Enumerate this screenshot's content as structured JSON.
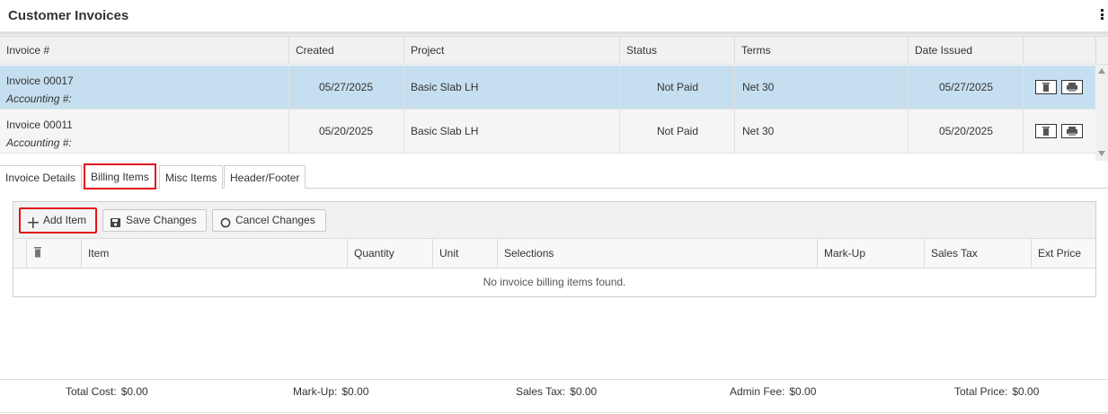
{
  "header": {
    "title": "Customer Invoices",
    "menu_icon": "kebab-icon"
  },
  "invoices": {
    "columns": [
      "Invoice #",
      "Created",
      "Project",
      "Status",
      "Terms",
      "Date Issued"
    ],
    "rows": [
      {
        "invoice": "Invoice 00017",
        "accounting": "Accounting #:",
        "created": "05/27/2025",
        "project": "Basic Slab LH",
        "status": "Not Paid",
        "terms": "Net 30",
        "issued": "05/27/2025",
        "selected": true
      },
      {
        "invoice": "Invoice 00011",
        "accounting": "Accounting #:",
        "created": "05/20/2025",
        "project": "Basic Slab LH",
        "status": "Not Paid",
        "terms": "Net 30",
        "issued": "05/20/2025",
        "selected": false
      }
    ]
  },
  "tabs": [
    {
      "label": "Invoice Details",
      "active": false
    },
    {
      "label": "Billing Items",
      "active": true
    },
    {
      "label": "Misc Items",
      "active": false
    },
    {
      "label": "Header/Footer",
      "active": false
    }
  ],
  "billing": {
    "toolbar": {
      "add_label": "Add Item",
      "save_label": "Save Changes",
      "cancel_label": "Cancel Changes"
    },
    "columns": [
      "Item",
      "Quantity",
      "Unit",
      "Selections",
      "Mark-Up",
      "Sales Tax",
      "Ext Price"
    ],
    "empty_message": "No invoice billing items found."
  },
  "totals": {
    "total_cost_label": "Total Cost:",
    "total_cost": "$0.00",
    "markup_label": "Mark-Up:",
    "markup": "$0.00",
    "sales_tax_label": "Sales Tax:",
    "sales_tax": "$0.00",
    "admin_fee_label": "Admin Fee:",
    "admin_fee": "$0.00",
    "total_price_label": "Total Price:",
    "total_price": "$0.00"
  },
  "colors": {
    "selected_row": "#c5dff0",
    "highlight": "#e0141b",
    "header_bg": "#f1f1f1"
  }
}
